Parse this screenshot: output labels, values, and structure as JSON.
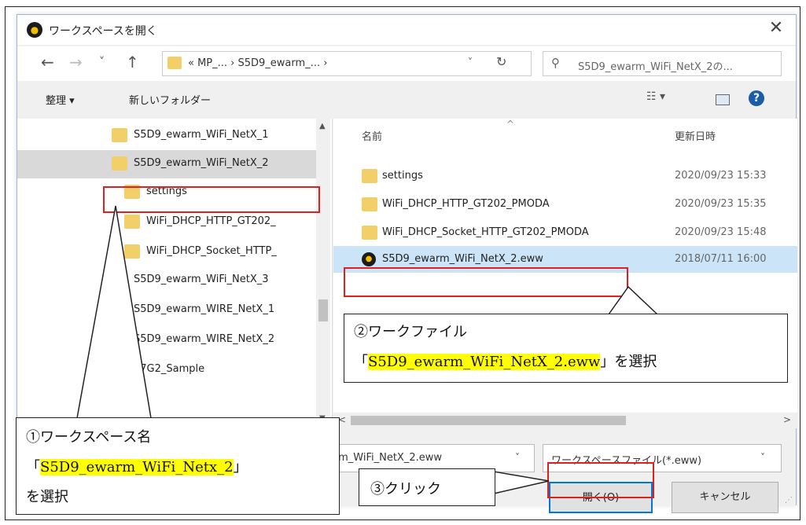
{
  "window": {
    "title": "ワークスペースを開く",
    "close_label": "✕"
  },
  "nav": {
    "back": "←",
    "forward": "→",
    "recent": "˅",
    "up": "↑",
    "address": "«  MP_...  ›  S5D9_ewarm_...  ›",
    "refresh": "↻",
    "search_placeholder": "S5D9_ewarm_WiFi_NetX_2の..."
  },
  "toolbar": {
    "organize": "整理 ▾",
    "new_folder": "新しいフォルダー",
    "view": "☷ ▾",
    "help": "?"
  },
  "tree": {
    "items": [
      {
        "label": "S5D9_ewarm_WiFi_NetX_1",
        "folder": true
      },
      {
        "label": "S5D9_ewarm_WiFi_NetX_2",
        "folder": true,
        "selected": true
      },
      {
        "label": "settings",
        "folder": true
      },
      {
        "label": "WiFi_DHCP_HTTP_GT202_",
        "folder": true
      },
      {
        "label": "WiFi_DHCP_Socket_HTTP_",
        "folder": true
      },
      {
        "label": "S5D9_ewarm_WiFi_NetX_3",
        "folder": false
      },
      {
        "label": "S5D9_ewarm_WIRE_NetX_1",
        "folder": false
      },
      {
        "label": "S5D9_ewarm_WIRE_NetX_2",
        "folder": false
      },
      {
        "label": "S7G2_Sample",
        "folder": false
      }
    ]
  },
  "files": {
    "col_name": "名前",
    "col_date": "更新日時",
    "rows": [
      {
        "name": "settings",
        "date": "2020/09/23 15:33",
        "type": "folder"
      },
      {
        "name": "WiFi_DHCP_HTTP_GT202_PMODA",
        "date": "2020/09/23 15:35",
        "type": "folder"
      },
      {
        "name": "WiFi_DHCP_Socket_HTTP_GT202_PMODA",
        "date": "2020/09/23 15:48",
        "type": "folder"
      },
      {
        "name": "S5D9_ewarm_WiFi_NetX_2.eww",
        "date": "2018/07/11 16:00",
        "type": "eww",
        "selected": true
      }
    ]
  },
  "bottom": {
    "filename": "rm_WiFi_NetX_2.eww",
    "filetype": "ワークスペースファイル(*.eww)",
    "open_label": "開く(O)",
    "cancel_label": "キャンセル"
  },
  "callouts": {
    "c1_line1": "①ワークスペース名",
    "c1_q_open": "「",
    "c1_hl": "S5D9_ewarm_WiFi_Netx_2",
    "c1_q_close": "」",
    "c1_line3": "を選択",
    "c2_line1": "②ワークファイル",
    "c2_q_open": "「",
    "c2_hl": "S5D9_ewarm_WiFi_NetX_2.eww",
    "c2_tail": "」を選択",
    "c3_text": "③クリック"
  },
  "colors": {
    "highlight": "#ffff00",
    "annotation_red": "#e0201f",
    "selection_blue": "#cce4f7",
    "primary_border": "#0078d7"
  }
}
